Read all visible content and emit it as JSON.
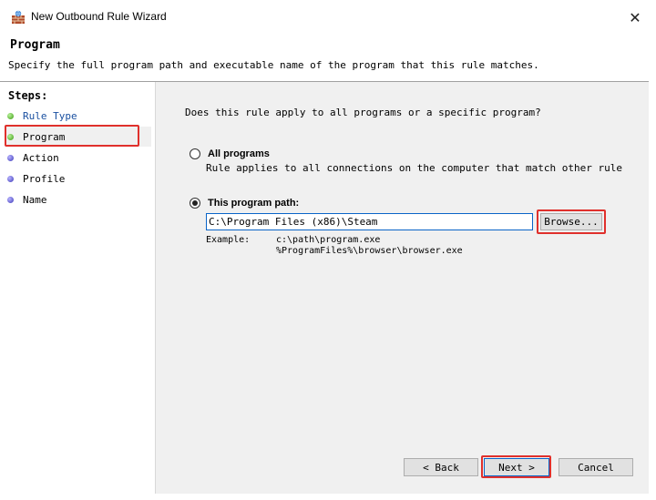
{
  "window": {
    "title": "New Outbound Rule Wizard",
    "close_glyph": "✕"
  },
  "header": {
    "title": "Program",
    "description": "Specify the full program path and executable name of the program that this rule matches."
  },
  "steps": {
    "title": "Steps:",
    "items": [
      {
        "label": "Rule Type",
        "status": "done",
        "link": true
      },
      {
        "label": "Program",
        "status": "current",
        "link": false
      },
      {
        "label": "Action",
        "status": "pending",
        "link": false
      },
      {
        "label": "Profile",
        "status": "pending",
        "link": false
      },
      {
        "label": "Name",
        "status": "pending",
        "link": false
      }
    ]
  },
  "main": {
    "question": "Does this rule apply to all programs or a specific program?",
    "all_programs": {
      "label": "All programs",
      "description": "Rule applies to all connections on the computer that match other rule",
      "selected": false
    },
    "this_program": {
      "label": "This program path:",
      "selected": true,
      "value": "C:\\Program Files (x86)\\Steam",
      "browse_label": "Browse...",
      "example_label": "Example:",
      "example_lines": [
        "c:\\path\\program.exe",
        "%ProgramFiles%\\browser\\browser.exe"
      ]
    }
  },
  "footer": {
    "back_label": "< Back",
    "next_label": "Next >",
    "cancel_label": "Cancel"
  },
  "colors": {
    "highlight_red": "#e0302c",
    "done_bullet": "#3c9a12",
    "pending_bullet": "#3c39b8",
    "link_blue": "#1a50a0",
    "focus_blue": "#0a64c8"
  }
}
